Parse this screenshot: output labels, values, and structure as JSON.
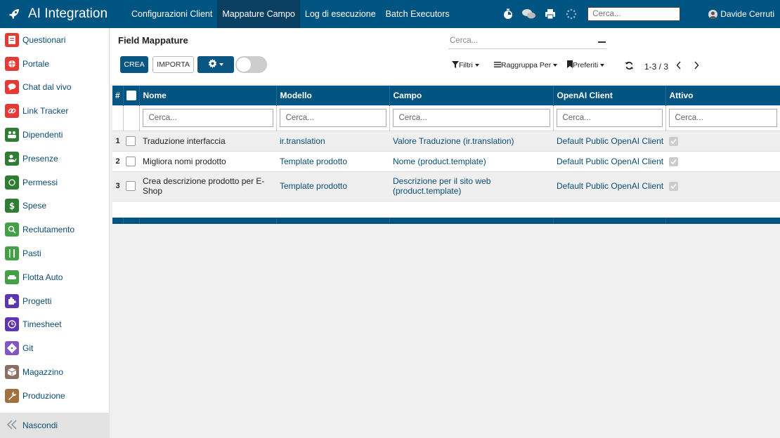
{
  "app": {
    "title": "AI Integration"
  },
  "nav": {
    "items": [
      {
        "label": "Configurazioni Client",
        "active": false
      },
      {
        "label": "Mappature Campo",
        "active": true
      },
      {
        "label": "Log di esecuzione",
        "active": false
      },
      {
        "label": "Batch Executors",
        "active": false
      }
    ]
  },
  "systray": {
    "search_placeholder": "Cerca...",
    "user_name": "Davide Cerruti"
  },
  "sidebar": {
    "items": [
      {
        "label": "Questionari",
        "icon": "clipboard-icon",
        "color": "#e53935"
      },
      {
        "label": "Portale",
        "icon": "globe-icon",
        "color": "#e53935"
      },
      {
        "label": "Chat dal vivo",
        "icon": "chat-icon",
        "color": "#e53935"
      },
      {
        "label": "Link Tracker",
        "icon": "link-icon",
        "color": "#e53935"
      },
      {
        "label": "Dipendenti",
        "icon": "users-icon",
        "color": "#2e7d32"
      },
      {
        "label": "Presenze",
        "icon": "user-check-icon",
        "color": "#2e7d32"
      },
      {
        "label": "Permessi",
        "icon": "sun-icon",
        "color": "#2e7d32"
      },
      {
        "label": "Spese",
        "icon": "dollar-icon",
        "color": "#2e7d32"
      },
      {
        "label": "Reclutamento",
        "icon": "magnifier-icon",
        "color": "#43a047"
      },
      {
        "label": "Pasti",
        "icon": "utensils-icon",
        "color": "#43a047"
      },
      {
        "label": "Flotta Auto",
        "icon": "car-icon",
        "color": "#43a047"
      },
      {
        "label": "Progetti",
        "icon": "puzzle-icon",
        "color": "#5e35b1"
      },
      {
        "label": "Timesheet",
        "icon": "clock-icon",
        "color": "#5e35b1"
      },
      {
        "label": "Git",
        "icon": "git-icon",
        "color": "#7e57c2"
      },
      {
        "label": "Magazzino",
        "icon": "box-icon",
        "color": "#8d6e63"
      },
      {
        "label": "Produzione",
        "icon": "wrench-icon",
        "color": "#a1703f"
      }
    ],
    "hide_label": "Nascondi"
  },
  "control_panel": {
    "breadcrumb": "Field Mappature",
    "search_placeholder": "Cerca...",
    "create_label": "CREA",
    "import_label": "IMPORTA",
    "filters_label": "Filtri",
    "groupby_label": "Raggruppa Per",
    "favorites_label": "Preferiti",
    "pager": "1-3 / 3"
  },
  "table": {
    "columns": [
      "#",
      "Nome",
      "Modello",
      "Campo",
      "OpenAI Client",
      "Attivo"
    ],
    "filter_placeholder": "Cerca...",
    "rows": [
      {
        "num": "1",
        "nome": "Traduzione interfaccia",
        "modello": "ir.translation",
        "campo": "Valore Traduzione (ir.translation)",
        "client": "Default Public OpenAI Client",
        "attivo": true
      },
      {
        "num": "2",
        "nome": "Migliora nomi prodotto",
        "modello": "Template prodotto",
        "campo": "Nome (product.template)",
        "client": "Default Public OpenAI Client",
        "attivo": true
      },
      {
        "num": "3",
        "nome": "Crea descrizione prodotto per E-Shop",
        "modello": "Template prodotto",
        "campo": "Descrizione per il sito web (product.template)",
        "client": "Default Public OpenAI Client",
        "attivo": true
      }
    ]
  }
}
